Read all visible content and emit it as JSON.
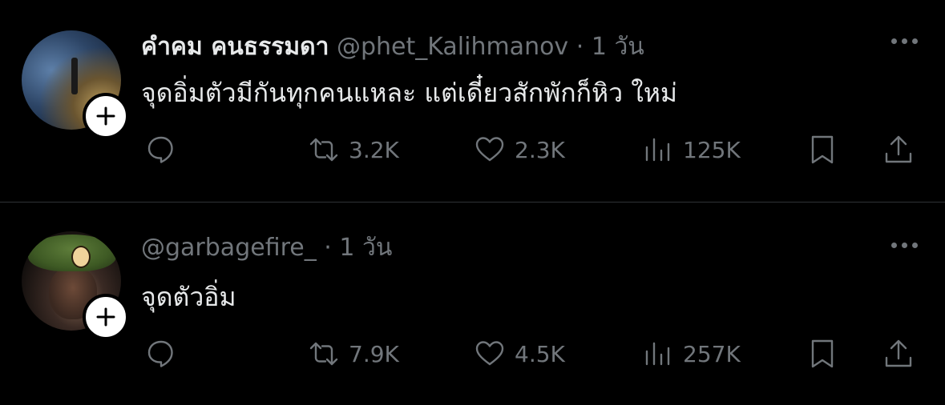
{
  "tweets": [
    {
      "name": "คำคม คนธรรมดา",
      "handle": "@phet_Kalihmanov",
      "dot": "·",
      "time": "1 วัน",
      "text": "จุดอิ่มตัวมีกันทุกคนแหละ แต่เดี๋ยวสักพักก็หิว ใหม่",
      "retweets": "3.2K",
      "likes": "2.3K",
      "views": "125K"
    },
    {
      "name": "",
      "handle": "@garbagefire_",
      "dot": "·",
      "time": "1 วัน",
      "text": "จุดตัวอิ่ม",
      "retweets": "7.9K",
      "likes": "4.5K",
      "views": "257K"
    }
  ],
  "icons": {
    "follow": "plus-icon",
    "more": "more-icon",
    "reply": "reply-icon",
    "retweet": "retweet-icon",
    "like": "heart-icon",
    "views": "views-icon",
    "bookmark": "bookmark-icon",
    "share": "share-icon"
  },
  "colors": {
    "background": "#000000",
    "text": "#e7e9ea",
    "secondary": "#71767b",
    "divider": "#2f3336"
  }
}
